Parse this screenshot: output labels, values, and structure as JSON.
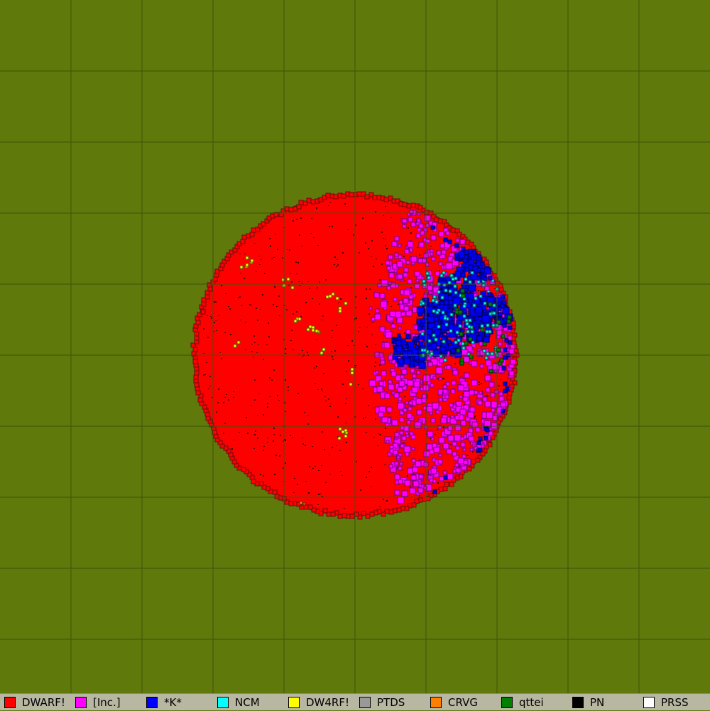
{
  "map": {
    "background_color": "#5f7a0b",
    "grid_color": "#3d520a",
    "grid_spacing": 100
  },
  "factions": [
    {
      "id": "dwarf",
      "label": "DWARF!",
      "color": "#ff0000"
    },
    {
      "id": "inc",
      "label": "[Inc.]",
      "color": "#ff00ff"
    },
    {
      "id": "k",
      "label": "*K*",
      "color": "#0000ff"
    },
    {
      "id": "ncm",
      "label": "NCM",
      "color": "#00ffff"
    },
    {
      "id": "dw4rf",
      "label": "DW4RF!",
      "color": "#ffff00"
    },
    {
      "id": "ptds",
      "label": "PTDS",
      "color": "#999999"
    },
    {
      "id": "crvg",
      "label": "CRVG",
      "color": "#ff8000"
    },
    {
      "id": "qttei",
      "label": "qttei",
      "color": "#008000"
    },
    {
      "id": "pn",
      "label": "PN",
      "color": "#000000"
    },
    {
      "id": "prss",
      "label": "PRSS",
      "color": "#ffffff"
    }
  ]
}
